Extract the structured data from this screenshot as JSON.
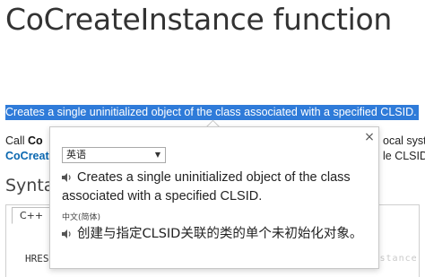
{
  "page": {
    "title": "CoCreateInstance function",
    "selected_text": "Creates a single uninitialized object of the class associated with a specified CLSID.",
    "line1_prefix": "Call ",
    "line1_bold": "Co",
    "line2_link": "CoCreat",
    "right_frag1": "ocal syste",
    "right_frag2": "le CLSID,",
    "syntax_heading": "Syntax",
    "code_tab": "C++",
    "code_fragment": "HRES"
  },
  "popup": {
    "close_label": "×",
    "source_language": "英语",
    "source_text": "Creates a single uninitialized object of the class associated with a specified CLSID.",
    "target_language_label": "中文(简体)",
    "target_text": "创建与指定CLSID关联的类的单个未初始化对象。",
    "speaker_icon": "speaker-icon"
  },
  "watermark": "http://blog.csdn.net/isinstance",
  "colors": {
    "selection": "#2f7bd9",
    "link": "#0a67b0"
  }
}
